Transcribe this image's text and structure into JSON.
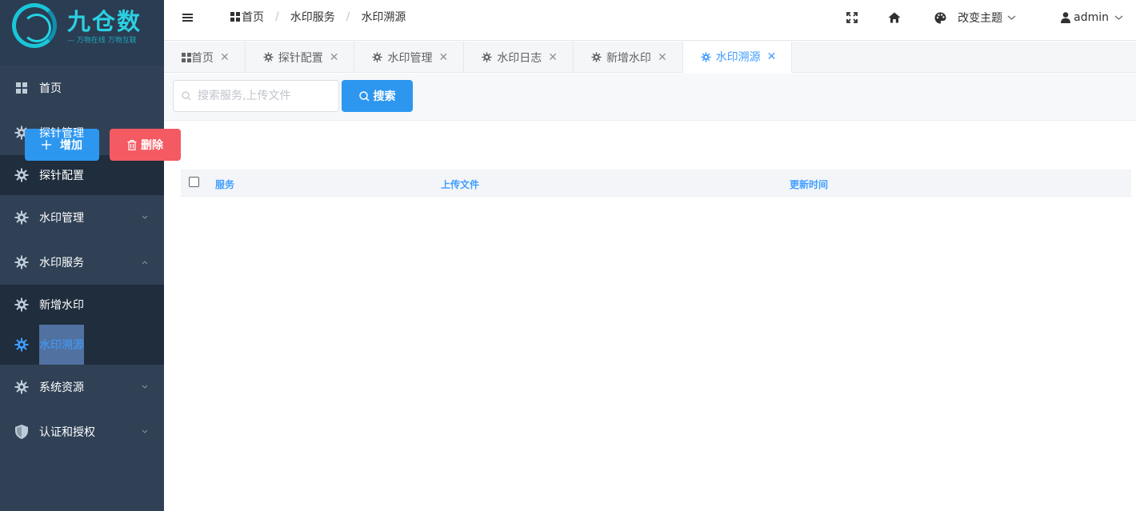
{
  "logo": {
    "brand": "九仓数",
    "slogan": "— 万物在线 万物互联"
  },
  "sidebar": {
    "items": [
      {
        "label": "首页",
        "icon": "dashboard-icon"
      },
      {
        "label": "探针管理",
        "icon": "gear-icon",
        "expanded": true
      },
      {
        "label": "探针配置",
        "icon": "gear-icon",
        "sub": true
      },
      {
        "label": "水印管理",
        "icon": "gear-icon",
        "expanded": false
      },
      {
        "label": "水印服务",
        "icon": "gear-icon",
        "expanded": true
      },
      {
        "label": "新增水印",
        "icon": "gear-icon",
        "sub": true
      },
      {
        "label": "水印溯源",
        "icon": "gear-icon",
        "sub": true,
        "active": true
      },
      {
        "label": "系统资源",
        "icon": "gear-icon",
        "expanded": false
      },
      {
        "label": "认证和授权",
        "icon": "shield-icon",
        "expanded": false
      }
    ]
  },
  "breadcrumb": {
    "home": "首页",
    "level1": "水印服务",
    "level2": "水印溯源"
  },
  "navbar": {
    "theme_label": "改变主题",
    "user": "admin"
  },
  "tags": [
    {
      "label": "首页",
      "icon": "dashboard-icon"
    },
    {
      "label": "探针配置",
      "icon": "gear-icon"
    },
    {
      "label": "水印管理",
      "icon": "gear-icon"
    },
    {
      "label": "水印日志",
      "icon": "gear-icon"
    },
    {
      "label": "新增水印",
      "icon": "gear-icon"
    },
    {
      "label": "水印溯源",
      "icon": "gear-icon",
      "active": true
    }
  ],
  "search": {
    "placeholder": "搜索服务,上传文件",
    "value": "",
    "button": "搜索"
  },
  "actions": {
    "add": "增加",
    "delete": "删除"
  },
  "table": {
    "columns": [
      "服务",
      "上传文件",
      "更新时间"
    ],
    "rows": []
  },
  "colors": {
    "sidebar": "#304156",
    "sidebar_sub": "#1f2d3d",
    "primary": "#2d97f0",
    "danger": "#f45a62",
    "active_text": "#409eff"
  }
}
